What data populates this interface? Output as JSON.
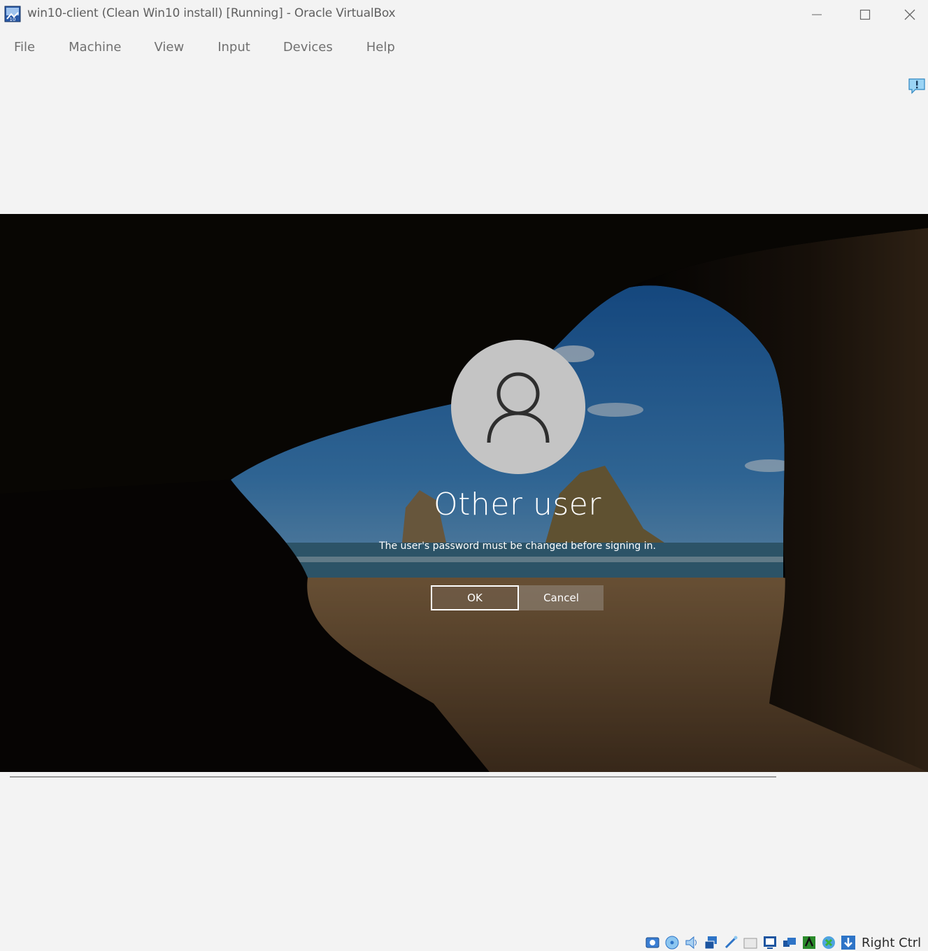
{
  "window": {
    "title": "win10-client (Clean Win10 install) [Running] - Oracle VirtualBox"
  },
  "menu": {
    "items": [
      "File",
      "Machine",
      "View",
      "Input",
      "Devices",
      "Help"
    ]
  },
  "vm": {
    "user_name": "Other user",
    "message": "The user's password must be changed before signing in.",
    "ok_label": "OK",
    "cancel_label": "Cancel"
  },
  "status": {
    "host_key": "Right Ctrl",
    "icons": [
      "hard-disk-icon",
      "optical-drive-icon",
      "audio-icon",
      "network-icon",
      "usb-icon",
      "shared-folders-icon",
      "display-icon",
      "recording-icon",
      "cpu-icon",
      "mouse-integration-icon",
      "keyboard-capture-icon"
    ]
  },
  "colors": {
    "window_bg": "#f3f3f3",
    "menu_text": "#707070",
    "vm_accent": "#2e74c7"
  }
}
